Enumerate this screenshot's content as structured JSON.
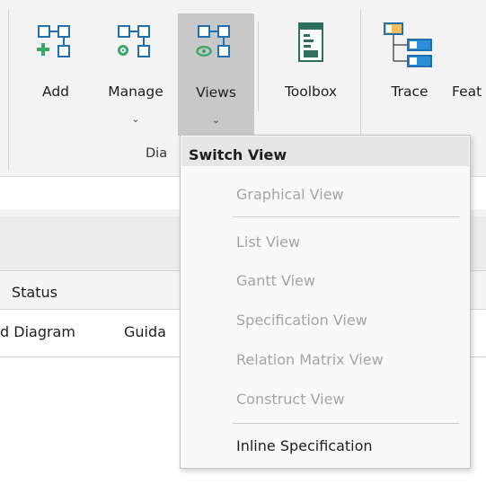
{
  "ribbon": {
    "buttons": [
      {
        "label": "Add"
      },
      {
        "label": "Manage"
      },
      {
        "label": "Views"
      },
      {
        "label": "Toolbox"
      },
      {
        "label": "Trace"
      },
      {
        "label": "Feat"
      }
    ],
    "chevron": "⌄",
    "group_label": "Dia",
    "active_color": "#c8c8c8",
    "accent_green": "#3aa86b",
    "accent_blue": "#1f6fb2"
  },
  "content": {
    "status_header": "Status",
    "tabs": [
      "d Diagram",
      "Guida"
    ]
  },
  "menu": {
    "title": "Switch View",
    "items": [
      {
        "label": "Graphical View",
        "enabled": false
      },
      {
        "label": "List View",
        "enabled": false
      },
      {
        "label": "Gantt View",
        "enabled": false
      },
      {
        "label": "Specification View",
        "enabled": false
      },
      {
        "label": "Relation Matrix View",
        "enabled": false
      },
      {
        "label": "Construct View",
        "enabled": false
      },
      {
        "label": "Inline Specification",
        "enabled": true
      }
    ]
  }
}
